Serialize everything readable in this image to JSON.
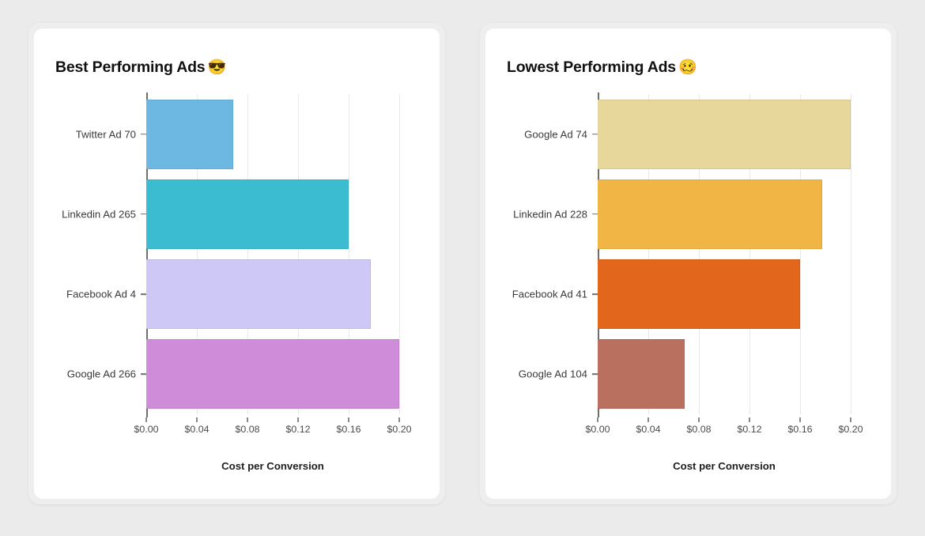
{
  "background_color": "#ebebeb",
  "panel_color": "#eeeeee",
  "card_color": "#ffffff",
  "axis": {
    "ticks": [
      "$0.00",
      "$0.04",
      "$0.08",
      "$0.12",
      "$0.16",
      "$0.20"
    ],
    "tick_values": [
      0.0,
      0.04,
      0.08,
      0.12,
      0.16,
      0.2
    ],
    "title": "Cost per Conversion",
    "min": 0.0,
    "max": 0.2
  },
  "panels": [
    {
      "title": "Best Performing Ads",
      "title_emoji": "😎",
      "emoji_name": "smiling-face-with-sunglasses"
    },
    {
      "title": "Lowest Performing Ads",
      "title_emoji": "🥴",
      "emoji_name": "woozy-face"
    }
  ],
  "chart_data": [
    {
      "type": "bar",
      "orientation": "horizontal",
      "title": "Best Performing Ads 😎",
      "xlabel": "Cost per Conversion",
      "ylabel": "",
      "xlim": [
        0.0,
        0.2
      ],
      "xticks": [
        0.0,
        0.04,
        0.08,
        0.12,
        0.16,
        0.2
      ],
      "xticklabels": [
        "$0.00",
        "$0.04",
        "$0.08",
        "$0.12",
        "$0.16",
        "$0.20"
      ],
      "grid": "vertical",
      "legend": "none",
      "categories": [
        "Twitter Ad 70",
        "Linkedin Ad 265",
        "Facebook Ad 4",
        "Google Ad 266"
      ],
      "values": [
        0.069,
        0.16,
        0.1775,
        0.2
      ],
      "colors": [
        "#6cb8e2",
        "#3cbcd0",
        "#cdc8f5",
        "#cf8cd8"
      ]
    },
    {
      "type": "bar",
      "orientation": "horizontal",
      "title": "Lowest Performing Ads 🥴",
      "xlabel": "Cost per Conversion",
      "ylabel": "",
      "xlim": [
        0.0,
        0.2
      ],
      "xticks": [
        0.0,
        0.04,
        0.08,
        0.12,
        0.16,
        0.2
      ],
      "xticklabels": [
        "$0.00",
        "$0.04",
        "$0.08",
        "$0.12",
        "$0.16",
        "$0.20"
      ],
      "grid": "vertical",
      "legend": "none",
      "categories": [
        "Google Ad 74",
        "Linkedin Ad 228",
        "Facebook Ad 41",
        "Google Ad 104"
      ],
      "values": [
        0.2,
        0.1775,
        0.16,
        0.069
      ],
      "colors": [
        "#e8d79a",
        "#f0b544",
        "#e2661b",
        "#b9705f"
      ]
    }
  ]
}
